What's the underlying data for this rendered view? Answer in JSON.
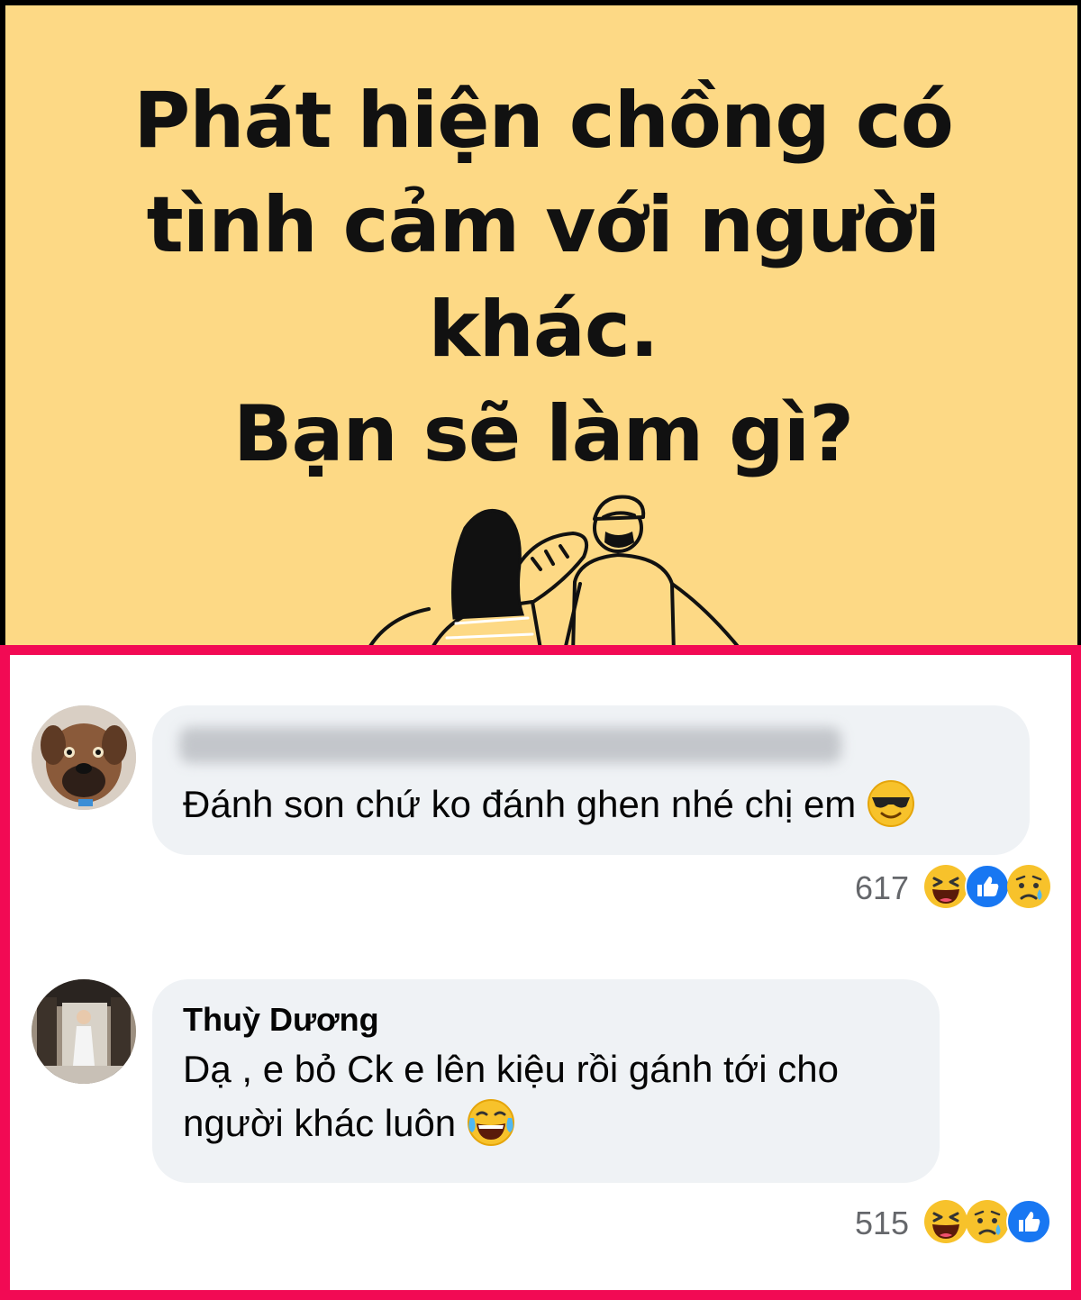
{
  "banner": {
    "title_lines": [
      "Phát hiện chồng có",
      "tình cảm với người",
      "khác.",
      "Bạn sẽ làm gì?"
    ],
    "background_color": "#fdd985"
  },
  "frame_color": "#f20a54",
  "comments": [
    {
      "author": "",
      "text": "Đánh son chứ ko đánh ghen nhé chị em",
      "emoji": "sunglasses-emoji",
      "reaction_count": "617",
      "reactions": [
        "haha",
        "like",
        "sad"
      ]
    },
    {
      "author": "Thuỳ Dương",
      "text_lines": [
        "Dạ , e bỏ Ck e lên kiệu rồi gánh tới cho",
        "người khác luôn"
      ],
      "emoji": "tears-of-joy-emoji",
      "reaction_count": "515",
      "reactions": [
        "haha",
        "sad",
        "like"
      ]
    }
  ]
}
